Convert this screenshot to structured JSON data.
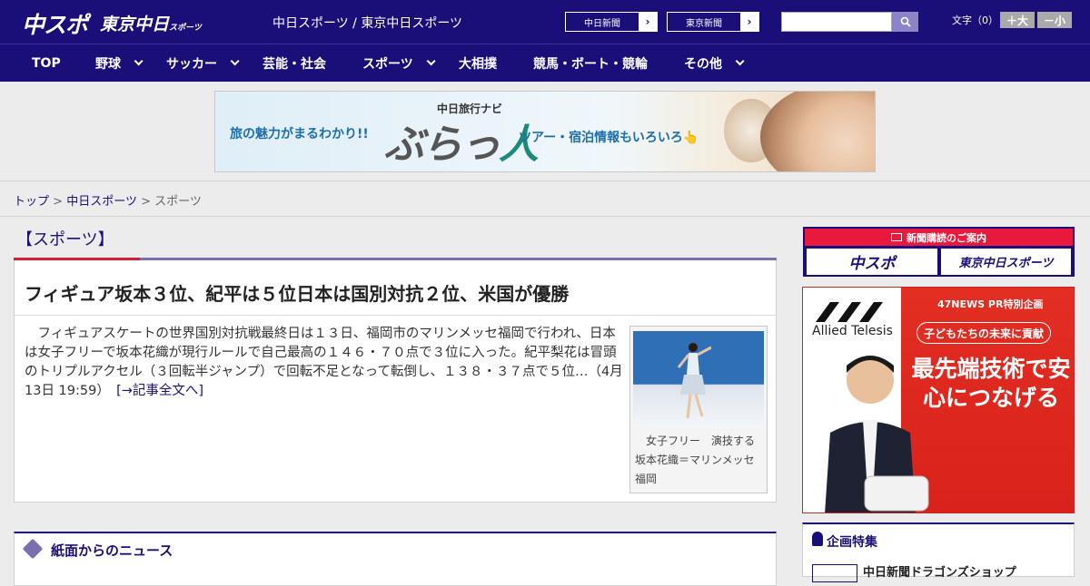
{
  "header": {
    "logo_chuspo": "中スポ",
    "logo_tokyo": "東京中日",
    "logo_tokyo_small": "スポーツ",
    "site_title": "中日スポーツ / 東京中日スポーツ",
    "paper_buttons": [
      {
        "label": "中日新聞",
        "arrow": "›"
      },
      {
        "label": "東京新聞",
        "arrow": "›"
      }
    ],
    "search": {
      "placeholder": "",
      "icon": "search-icon"
    },
    "font_size_label": "文字（0）",
    "font_plus": "＋大",
    "font_minus": "－小"
  },
  "nav": {
    "items": [
      {
        "label": "TOP",
        "has_menu": false
      },
      {
        "label": "野球",
        "has_menu": true
      },
      {
        "label": "サッカー",
        "has_menu": true
      },
      {
        "label": "芸能・社会",
        "has_menu": false
      },
      {
        "label": "スポーツ",
        "has_menu": true
      },
      {
        "label": "大相撲",
        "has_menu": false
      },
      {
        "label": "競馬・ボート・競輪",
        "has_menu": false
      },
      {
        "label": "その他",
        "has_menu": true
      }
    ]
  },
  "banner": {
    "left_text": "旅の魅力がまるわかり!!",
    "brand": "中日旅行ナビ",
    "logo_text_a": "ぶらっ",
    "logo_text_b": "人",
    "right_text": "ツアー・宿泊情報もいろいろ👆"
  },
  "breadcrumb": {
    "items": [
      "トップ",
      "中日スポーツ"
    ],
    "current": "スポーツ",
    "separator": ">"
  },
  "section": {
    "title": "【スポーツ】"
  },
  "article": {
    "title": "フィギュア坂本３位、紀平は５位日本は国別対抗２位、米国が優勝",
    "body": "フィギュアスケートの世界国別対抗戦最終日は１３日、福岡市のマリンメッセ福岡で行われ、日本は女子フリーで坂本花織が現行ルールで自己最高の１４６・７０点で３位に入った。紀平梨花は冒頭のトリプルアクセル（３回転半ジャンプ）で回転不足となって転倒し、１３８・３７点で５位…（4月13日 19:59）",
    "more_link": "[→記事全文へ]",
    "photo_caption": "女子フリー　演技する坂本花織＝マリンメッセ福岡"
  },
  "news_section": {
    "title": "紙面からのニュース"
  },
  "sidebar": {
    "subscribe_head": "新聞購読のご案内",
    "subscribe_buttons": [
      "中スポ",
      "東京中日スポーツ"
    ],
    "ad": {
      "header": "47NEWS PR特別企画",
      "pill": "子どもたちの未来に貢献",
      "headline": "最先端技術で安心につなげる",
      "brand": "Allied Telesis"
    },
    "feature": {
      "title": "企画特集",
      "first_item": "中日新聞ドラゴンズショップ"
    }
  },
  "colors": {
    "navy": "#1a0f78",
    "accent_red": "#d21f35",
    "ad_red": "#e22e23"
  }
}
